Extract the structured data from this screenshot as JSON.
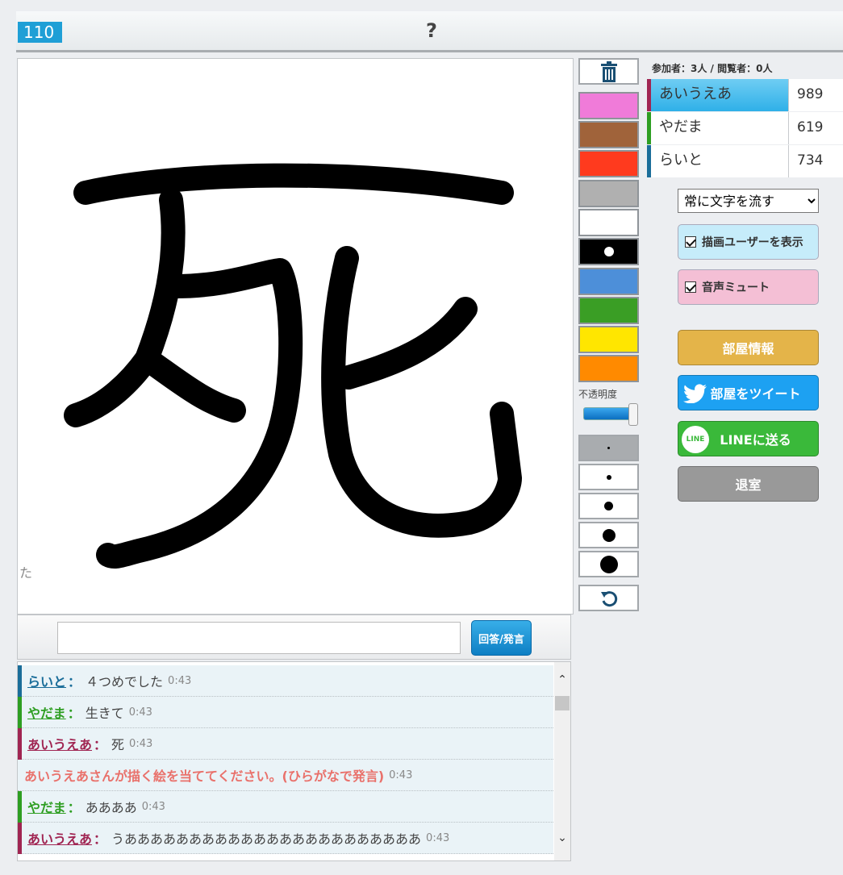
{
  "header": {
    "timer": "110",
    "word_hint": "?"
  },
  "canvas": {
    "drawer_hint": "た"
  },
  "palette": {
    "colors": [
      "#f07bd9",
      "#a0633a",
      "#ff3a1e",
      "#b0b0b0",
      "#ffffff",
      "#000000",
      "#4d8fd9",
      "#3a9e25",
      "#ffe600",
      "#ff8a00"
    ],
    "selected_color": "#000000",
    "opacity_label": "不透明度",
    "opacity_value": 1.0,
    "brush_sizes": [
      "tiny",
      "small",
      "medium",
      "large",
      "xlarge"
    ],
    "selected_size": "tiny",
    "trash_icon": "trash-icon",
    "undo_icon": "undo-icon"
  },
  "room": {
    "counts": "参加者：3人 / 閲覧者：0人",
    "players": [
      {
        "name": "あいうえあ",
        "score": "989",
        "color": "#a02552",
        "active": true
      },
      {
        "name": "やだま",
        "score": "619",
        "color": "#2e9e22",
        "active": false
      },
      {
        "name": "らいと",
        "score": "734",
        "color": "#1a6d99",
        "active": false
      }
    ]
  },
  "settings": {
    "flow_select": "常に文字を流す",
    "show_drawer_label": "描画ユーザーを表示",
    "mute_label": "音声ミュート"
  },
  "buttons": {
    "room_info": "部屋情報",
    "tweet": "部屋をツイート",
    "line": "LINEに送る",
    "line_logo": "LINE",
    "exit": "退室"
  },
  "answer": {
    "input_value": "",
    "submit_label": "回答/発言"
  },
  "chat": {
    "messages": [
      {
        "user": "らいと",
        "text": "４つめでした",
        "time": "0:43",
        "color": "#1a6d99"
      },
      {
        "user": "やだま",
        "text": "生きて",
        "time": "0:43",
        "color": "#2e9e22"
      },
      {
        "user": "あいうえあ",
        "text": "死",
        "time": "0:43",
        "color": "#a02552"
      },
      {
        "system": "あいうえあさんが描く絵を当ててください。(ひらがなで発言)",
        "time": "0:43"
      },
      {
        "user": "やだま",
        "text": "ああああ",
        "time": "0:43",
        "color": "#2e9e22"
      },
      {
        "user": "あいうえあ",
        "text": "うあああああああああああああああああああああああ",
        "time": "0:43",
        "color": "#a02552"
      }
    ]
  },
  "colors": {
    "accent": "#1f9fd6",
    "room_info_bg": "#e4b449",
    "tweet_bg": "#1da1f2",
    "line_bg": "#3ab93a",
    "exit_bg": "#999999",
    "toggle_blue": "#c6ecfa",
    "toggle_pink": "#f4bfd5"
  }
}
